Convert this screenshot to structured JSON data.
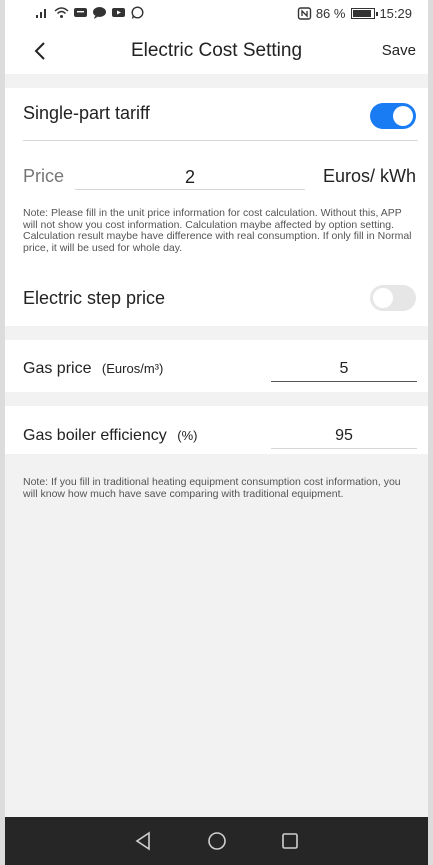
{
  "status_bar": {
    "battery": "86 %",
    "time": "15:29"
  },
  "header": {
    "title": "Electric Cost Setting",
    "save_label": "Save"
  },
  "single_part_tariff": {
    "label": "Single-part tariff",
    "enabled": true
  },
  "price": {
    "label": "Price",
    "value": "2",
    "unit": "Euros/ kWh"
  },
  "price_note": "Note: Please fill in the unit price information for cost calculation. Without this, APP will not show you cost information. Calculation maybe affected by option setting. Calculation result maybe have difference with real consumption. If only fill in Normal price, it will be used for whole day.",
  "electric_step_price": {
    "label": "Electric step price",
    "enabled": false
  },
  "gas_price": {
    "label": "Gas price",
    "unit": "(Euros/m³)",
    "value": "5"
  },
  "gas_boiler_efficiency": {
    "label": "Gas boiler efficiency",
    "unit": "(%)",
    "value": "95"
  },
  "bottom_note": "Note: If you fill in traditional heating equipment consumption cost information, you will know how much have save comparing with traditional equipment.",
  "colors": {
    "accent": "#1a7cf3",
    "background": "#f2f2f2",
    "nav_bar": "#262626"
  }
}
